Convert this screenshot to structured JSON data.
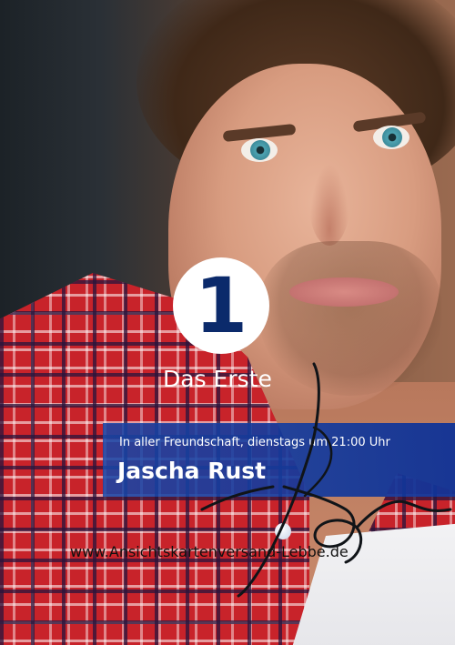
{
  "channel_logo_glyph": "1",
  "channel_name": "Das Erste",
  "banner": {
    "show_line": "In aller Freundschaft, dienstags um 21:00 Uhr",
    "person_name": "Jascha Rust"
  },
  "watermark_url": "www.Ansichtskartenversand-Lebbe.de",
  "colors": {
    "banner_blue": "#1a4fa8",
    "logo_navy": "#0b2a6b",
    "shirt_red": "#c8232a"
  }
}
